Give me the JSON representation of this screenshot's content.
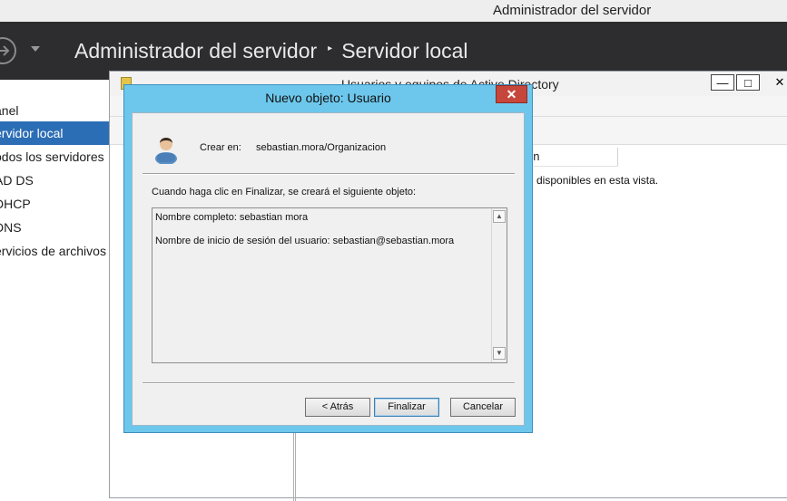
{
  "server_manager": {
    "window_title": "Administrador del servidor",
    "breadcrumb": {
      "root": "Administrador del servidor",
      "separator": "▸",
      "current": "Servidor local"
    },
    "sidebar": [
      {
        "label": "anel",
        "active": false
      },
      {
        "label": "ervidor local",
        "active": true
      },
      {
        "label": "odos los servidores",
        "active": false
      },
      {
        "label": "AD DS",
        "active": false
      },
      {
        "label": "DHCP",
        "active": false
      },
      {
        "label": "DNS",
        "active": false
      },
      {
        "label": "ervicios de archivos",
        "active": false
      }
    ]
  },
  "ad_window": {
    "title": "Usuarios y equipos de Active Directory",
    "column_header": "ón",
    "empty_message": "disponibles en esta vista.",
    "controls": {
      "minimize": "—",
      "maximize": "□",
      "close": "✕"
    }
  },
  "dialog": {
    "title": "Nuevo objeto: Usuario",
    "close_glyph": "✕",
    "create_in_label": "Crear en:",
    "create_in_path": "sebastian.mora/Organizacion",
    "intro": "Cuando haga clic en Finalizar, se creará el siguiente objeto:",
    "summary": [
      "Nombre completo: sebastian mora",
      "Nombre de inicio de sesión del usuario: sebastian@sebastian.mora"
    ],
    "buttons": {
      "back": "< Atrás",
      "finish": "Finalizar",
      "cancel": "Cancelar"
    }
  }
}
